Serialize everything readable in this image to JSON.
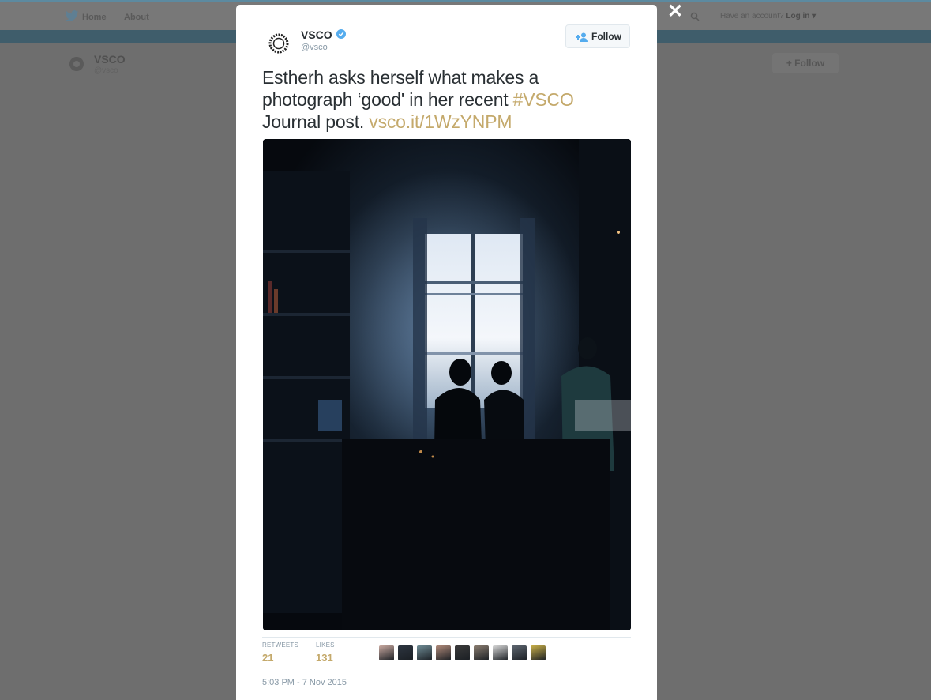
{
  "background_page": {
    "nav": {
      "home": "Home",
      "about": "About"
    },
    "account_prompt": "Have an account?",
    "login": "Log in",
    "profile_name": "VSCO",
    "profile_handle": "@vsco",
    "follow_label": "Follow"
  },
  "modal": {
    "author": {
      "name": "VSCO",
      "handle": "@vsco",
      "verified": true
    },
    "follow_label": "Follow",
    "tweet": {
      "text_1": "Estherh asks herself what makes a photograph ‘good' in her recent ",
      "hashtag": "#VSCO",
      "text_2": " Journal post. ",
      "link": "vsco.it/1WzYNPM"
    },
    "stats": {
      "retweets_label": "RETWEETS",
      "retweets": "21",
      "likes_label": "LIKES",
      "likes": "131"
    },
    "likers": [
      "#c9a9a0",
      "#2d3540",
      "#6f8c95",
      "#b08a7a",
      "#3a3a3a",
      "#8a7d70",
      "#d8d8d8",
      "#5e6670",
      "#c9b048"
    ],
    "timestamp": "5:03 PM - 7 Nov 2015"
  },
  "colors": {
    "accent": "#c4a96b",
    "verified": "#55acee",
    "text": "#292f33",
    "muted": "#8899a6"
  }
}
